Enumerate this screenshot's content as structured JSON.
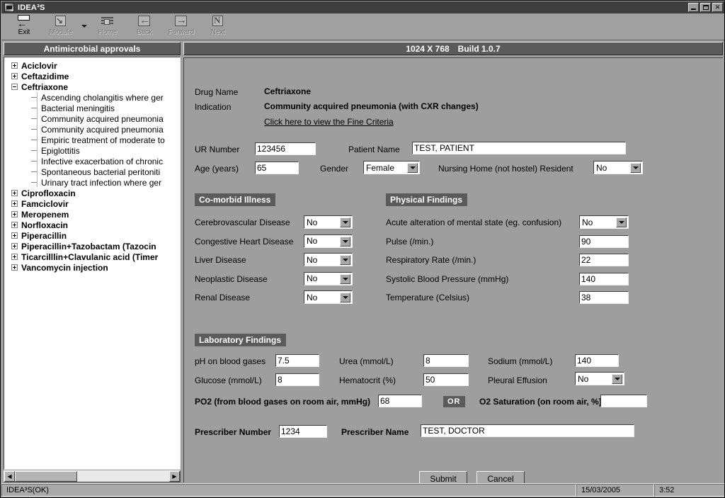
{
  "window": {
    "title": "IDEA³S",
    "minimize": "–",
    "maximize": "□",
    "close": "✕"
  },
  "toolbar": {
    "items": [
      {
        "label": "Exit",
        "icon": "exit-icon",
        "disabled": false
      },
      {
        "label": "Module",
        "icon": "module-icon",
        "disabled": true
      },
      {
        "label": "Home",
        "icon": "home-icon",
        "disabled": true
      },
      {
        "label": "Back",
        "icon": "back-arrow-icon",
        "disabled": true
      },
      {
        "label": "Forward",
        "icon": "forward-arrow-icon",
        "disabled": true
      },
      {
        "label": "Next",
        "icon": "next-icon",
        "disabled": true
      }
    ]
  },
  "tree": {
    "header": "Antimicrobial approvals",
    "nodes": [
      {
        "label": "Aciclovir",
        "type": "root",
        "expanded": false
      },
      {
        "label": "Ceftazidime",
        "type": "root",
        "expanded": false
      },
      {
        "label": "Ceftriaxone",
        "type": "root",
        "expanded": true
      },
      {
        "label": "Ascending cholangitis where ger",
        "type": "child"
      },
      {
        "label": "Bacterial meningitis",
        "type": "child"
      },
      {
        "label": "Community acquired pneumonia",
        "type": "child"
      },
      {
        "label": "Community acquired pneumonia",
        "type": "child"
      },
      {
        "label": "Empiric treatment of moderate to",
        "type": "child"
      },
      {
        "label": "Epiglottitis",
        "type": "child"
      },
      {
        "label": "Infective exacerbation of chronic",
        "type": "child"
      },
      {
        "label": "Spontaneous bacterial peritoniti",
        "type": "child"
      },
      {
        "label": "Urinary tract infection where ger",
        "type": "child"
      },
      {
        "label": "Ciprofloxacin",
        "type": "root",
        "expanded": false
      },
      {
        "label": "Famciclovir",
        "type": "root",
        "expanded": false
      },
      {
        "label": "Meropenem",
        "type": "root",
        "expanded": false
      },
      {
        "label": "Norfloxacin",
        "type": "root",
        "expanded": false
      },
      {
        "label": "Piperacillin",
        "type": "root",
        "expanded": false
      },
      {
        "label": "Piperacillin+Tazobactam (Tazocin",
        "type": "root",
        "expanded": false
      },
      {
        "label": "Ticarcilllin+Clavulanic acid (Timer",
        "type": "root",
        "expanded": false
      },
      {
        "label": "Vancomycin injection",
        "type": "root",
        "expanded": false
      }
    ]
  },
  "main_header": {
    "resolution": "1024 X 768",
    "build": "Build 1.0.7"
  },
  "form": {
    "drug_name_label": "Drug Name",
    "drug_name_value": "Ceftriaxone",
    "indication_label": "Indication",
    "indication_value": "Community acquired pneumonia (with CXR changes)",
    "criteria_link": "Click here to view the Fine Criteria",
    "ur_label": "UR Number",
    "ur_value": "123456",
    "patient_name_label": "Patient Name",
    "patient_name_value": "TEST, PATIENT",
    "age_label": "Age (years)",
    "age_value": "65",
    "gender_label": "Gender",
    "gender_value": "Female",
    "nursing_home_label": "Nursing Home (not hostel) Resident",
    "nursing_home_value": "No",
    "comorbid_title": "Co-morbid Illness",
    "comorbid": [
      {
        "label": "Cerebrovascular Disease",
        "value": "No"
      },
      {
        "label": "Congestive Heart Disease",
        "value": "No"
      },
      {
        "label": "Liver Disease",
        "value": "No"
      },
      {
        "label": "Neoplastic Disease",
        "value": "No"
      },
      {
        "label": "Renal Disease",
        "value": "No"
      }
    ],
    "physical_title": "Physical Findings",
    "physical": [
      {
        "label": "Acute alteration of mental state (eg. confusion)",
        "value": "No",
        "type": "select"
      },
      {
        "label": "Pulse (/min.)",
        "value": "90",
        "type": "text"
      },
      {
        "label": "Respiratory Rate (/min.)",
        "value": "22",
        "type": "text"
      },
      {
        "label": "Systolic Blood Pressure (mmHg)",
        "value": "140",
        "type": "text"
      },
      {
        "label": "Temperature (Celsius)",
        "value": "38",
        "type": "text"
      }
    ],
    "lab_title": "Laboratory Findings",
    "ph_label": "pH on blood gases",
    "ph_value": "7.5",
    "urea_label": "Urea (mmol/L)",
    "urea_value": "8",
    "sodium_label": "Sodium (mmol/L)",
    "sodium_value": "140",
    "glucose_label": "Glucose (mmol/L)",
    "glucose_value": "8",
    "hematocrit_label": "Hematocrit (%)",
    "hematocrit_value": "50",
    "pleural_label": "Pleural Effusion",
    "pleural_value": "No",
    "po2_label": "PO2 (from blood gases on room air, mmHg)",
    "po2_value": "68",
    "or_badge": "OR",
    "o2sat_label": "O2 Saturation (on room air, %)",
    "o2sat_value": "",
    "prescriber_number_label": "Prescriber Number",
    "prescriber_number_value": "1234",
    "prescriber_name_label": "Prescriber Name",
    "prescriber_name_value": "TEST, DOCTOR",
    "submit_label": "Submit",
    "cancel_label": "Cancel"
  },
  "statusbar": {
    "message": "IDEA³S(OK)",
    "date": "15/03/2005",
    "time": "3:52"
  }
}
